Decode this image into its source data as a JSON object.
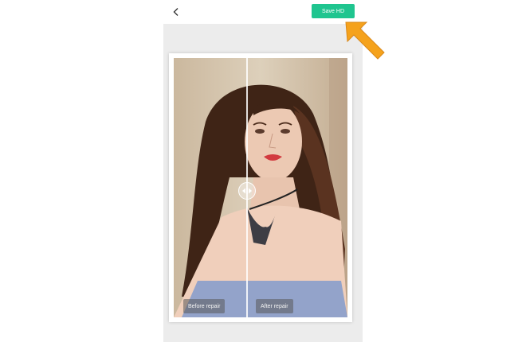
{
  "toolbar": {
    "back_icon": "chevron-left-icon",
    "save_label": "Save HD"
  },
  "comparison": {
    "before_label": "Before repair",
    "after_label": "After repair",
    "handle_icon": "left-right-arrows-icon"
  },
  "annotation": {
    "arrow_icon": "pointer-arrow-icon",
    "arrow_color": "#f5a21c"
  },
  "colors": {
    "accent": "#1fc58f",
    "screen_background": "#ececec"
  }
}
